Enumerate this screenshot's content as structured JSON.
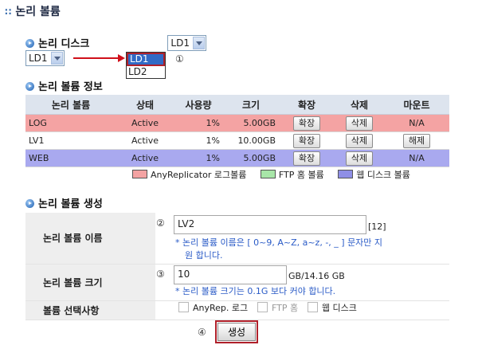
{
  "header": {
    "title": "논리 볼륨"
  },
  "disk": {
    "section_title": "논리 디스크",
    "selected": "LD1",
    "open_select_value": "LD1",
    "options": [
      "LD1",
      "LD2"
    ],
    "marker": "①"
  },
  "info": {
    "section_title": "논리 볼륨 정보",
    "columns": [
      "논리 볼륨",
      "상태",
      "사용량",
      "크기",
      "확장",
      "삭제",
      "마운트"
    ],
    "rows": [
      {
        "name": "LOG",
        "status": "Active",
        "usage": "1%",
        "size": "5.00GB",
        "expand": "확장",
        "delete": "삭제",
        "mount": "N/A",
        "row_color": "#f4a3a3"
      },
      {
        "name": "LV1",
        "status": "Active",
        "usage": "1%",
        "size": "10.00GB",
        "expand": "확장",
        "delete": "삭제",
        "mount": "해제",
        "row_color": "#ffffff"
      },
      {
        "name": "WEB",
        "status": "Active",
        "usage": "1%",
        "size": "5.00GB",
        "expand": "확장",
        "delete": "삭제",
        "mount": "N/A",
        "row_color": "#a9a9ef"
      }
    ],
    "legend": [
      {
        "label": "AnyReplicator 로그볼륨",
        "color": "#f4a3a3"
      },
      {
        "label": "FTP 홈 볼륨",
        "color": "#a8e6a8"
      },
      {
        "label": "웹 디스크 볼륨",
        "color": "#8f8fe6"
      }
    ]
  },
  "create": {
    "section_title": "논리 볼륨 생성",
    "name_label": "논리 볼륨 이름",
    "name_marker": "②",
    "name_value": "LV2",
    "name_max": "[12]",
    "name_hint_1": "* 논리 볼륨 이름은 [ 0~9, A~Z, a~z, -, _ ] 문자만 지",
    "name_hint_2": "원 합니다.",
    "size_label": "논리 볼륨 크기",
    "size_marker": "③",
    "size_value": "10",
    "size_suffix": "GB/14.16 GB",
    "size_hint": "* 논리 볼륨 크기는 0.1G 보다 커야 합니다.",
    "option_label": "볼륨 선택사항",
    "options": [
      "AnyRep. 로그",
      "FTP 홈",
      "웹 디스크"
    ],
    "button_marker": "④",
    "button_label": "생성"
  }
}
